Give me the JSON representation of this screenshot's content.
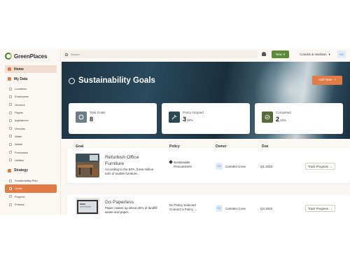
{
  "app": {
    "logo": "GreenPlaces"
  },
  "sidebar": {
    "home": "Home",
    "my_data": "My Data",
    "my_data_items": [
      "Locations",
      "Employees",
      "Vendors",
      "Flights",
      "Appliances",
      "Vehicles",
      "Water",
      "Waste",
      "Purchases",
      "Utilities"
    ],
    "strategy": "Strategy",
    "strategy_items": [
      "Sustainability Plan",
      "Goals",
      "Projects",
      "Policies"
    ],
    "active_item": "Goals"
  },
  "topbar": {
    "search_placeholder": "Search",
    "new_label": "New",
    "org_label": "Conekin & Hardison",
    "avatar_initials": "CC"
  },
  "hero": {
    "title": "Sustainability Goals",
    "add_new_label": "Add New"
  },
  "stats": [
    {
      "label": "Total Goals",
      "value": "8",
      "pct": ""
    },
    {
      "label": "Policy Adopted",
      "value": "3",
      "pct": "38%"
    },
    {
      "label": "Completed",
      "value": "2",
      "pct": "25%"
    }
  ],
  "table": {
    "headers": {
      "goal": "Goal",
      "policy": "Policy",
      "owner": "Owner",
      "due": "Due Date"
    },
    "rows": [
      {
        "title": "Refurbish Office Furniture",
        "desc": "According to the EPA, three million tons of usable furniture...",
        "policy_line1": "Sustainable",
        "policy_line2": "Procurement",
        "owner_initials": "CC",
        "owner": "Camden Cone",
        "due": "Q1 2023",
        "action": "Track Progress"
      },
      {
        "title": "Go Paperless",
        "desc": "Paper makes up about 25% of landfill waste and paper...",
        "policy_line1": "No Policy Selected",
        "policy_line2": "Connect a Policy",
        "owner_initials": "CC",
        "owner": "Camden Cone",
        "due": "Q4 2022",
        "action": "Track Progress"
      }
    ]
  },
  "colors": {
    "accent": "#e27b45",
    "brand_green": "#5c8a3a",
    "avatar_bg": "#e1ecf7"
  }
}
